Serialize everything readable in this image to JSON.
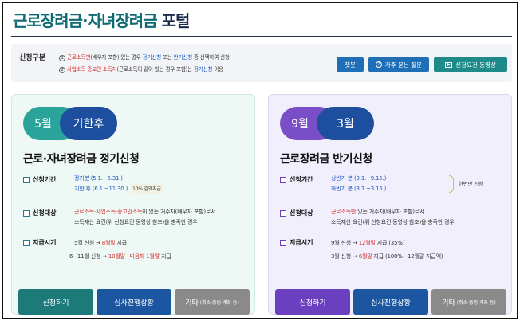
{
  "header": {
    "title_accent": "근로장려금·자녀장려금",
    "title_rest": " 포털"
  },
  "info": {
    "label": "신청구분",
    "line1": {
      "num": "1",
      "a": "근로소득만",
      "b": "(배우자 포함) 있는 경우 ",
      "c": "정기신청",
      "d": " 또는 ",
      "e": "반기신청",
      "f": " 중 선택하여 신청"
    },
    "line2": {
      "num": "2",
      "a": "사업소득·종교인 소득자",
      "b": "(근로소득이 같이 있는 경우 포함)는 ",
      "c": "정기신청",
      "d": " 이용"
    },
    "buttons": {
      "chatbot": "챗봇",
      "faq": "자주 묻는 질문",
      "video": "신청요건 동영상"
    }
  },
  "regular": {
    "pill_a": "5월",
    "pill_b": "기한후",
    "title": "근로·자녀장려금 정기신청",
    "period_label": "신청기간",
    "period_1": "정기분 (5.1.~5.31.)",
    "period_2": "기한 후 (6.1.~11.30.)",
    "period_2_tag": "10% 감액지급",
    "target_label": "신청대상",
    "target_1a": "근로소득·사업소득·종교인소득",
    "target_1b": "이 있는 거주자(배우자 포함)로서",
    "target_2": "소득재산 요건(위 신청요건 동영상 참조)을 충족한 경우",
    "pay_label": "지급시기",
    "pay_1a": "5월 신청 → ",
    "pay_1b": "8월말",
    "pay_1c": " 지급",
    "pay_2a": "6~11월 신청 → ",
    "pay_2b": "10월말~다음해 1월말",
    "pay_2c": " 지급",
    "btn_apply": "신청하기",
    "btn_status": "심사진행상황",
    "btn_etc": "기타",
    "btn_etc_small": "(취소·증빙·계좌 등)"
  },
  "half": {
    "pill_a": "9월",
    "pill_b": "3월",
    "title": "근로장려금 반기신청",
    "period_label": "신청기간",
    "period_1": "상반기 분 (9.1.~9.15.)",
    "period_2": "하반기 분 (3.1.~3.15.)",
    "period_note": "한번만 신청",
    "target_label": "신청대상",
    "target_1a": "근로소득만",
    "target_1b": " 있는 거주자(배우자 포함)로서",
    "target_2": "소득재산 요건(위 신청요건 동영상 참조)을 충족한 경우",
    "pay_label": "지급시기",
    "pay_1a": "9월 신청 → ",
    "pay_1b": "12월말",
    "pay_1c": " 지급 (35%)",
    "pay_2a": "3월 신청 → ",
    "pay_2b": "6월말",
    "pay_2c": " 지급 (100% - 12월말 지급액)",
    "btn_apply": "신청하기",
    "btn_status": "심사진행상황",
    "btn_etc": "기타",
    "btn_etc_small": "(취소·증빙·계좌 등)"
  }
}
